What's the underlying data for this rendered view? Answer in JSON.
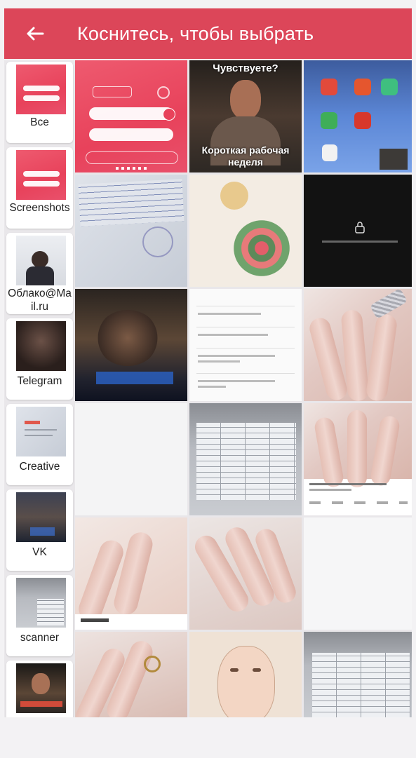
{
  "header": {
    "title": "Коснитесь, чтобы выбрать",
    "back_icon": "arrow-left-icon"
  },
  "albums": [
    {
      "label": "Все"
    },
    {
      "label": "Screenshots"
    },
    {
      "label": "Облако@Mail.ru"
    },
    {
      "label": "Telegram"
    },
    {
      "label": "Creative"
    },
    {
      "label": "VK"
    },
    {
      "label": "scanner"
    }
  ],
  "photos": {
    "meme_top": "Чувствуете?",
    "meme_bottom": "Короткая рабочая неделя"
  },
  "colors": {
    "accent": "#dc4659",
    "background": "#f3f2f4"
  }
}
